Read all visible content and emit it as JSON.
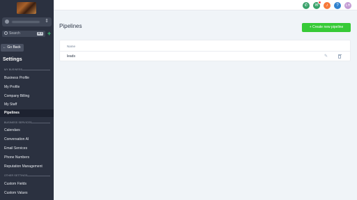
{
  "sidebar": {
    "search_label": "Search",
    "search_shortcut": "⌘ K",
    "add_icon": "+",
    "go_back": "← Go Back",
    "settings_title": "Settings",
    "sections": {
      "my_business": "MY BUSINESS",
      "business_services": "BUSINESS SERVICES",
      "other_settings": "OTHER SETTINGS"
    },
    "items": [
      {
        "label": "Business Profile"
      },
      {
        "label": "My Profile"
      },
      {
        "label": "Company Billing"
      },
      {
        "label": "My Staff"
      },
      {
        "label": "Pipelines",
        "active": true
      },
      {
        "label": "Calendars"
      },
      {
        "label": "Conversation AI"
      },
      {
        "label": "Email Services"
      },
      {
        "label": "Phone Numbers"
      },
      {
        "label": "Reputation Management"
      },
      {
        "label": "Custom Fields"
      },
      {
        "label": "Custom Values"
      }
    ]
  },
  "topbar": {
    "icons": [
      {
        "name": "phone-icon",
        "glyph": "✆",
        "color": "#38a169"
      },
      {
        "name": "megaphone-icon",
        "glyph": "✉",
        "color": "#38a169"
      },
      {
        "name": "bell-icon",
        "glyph": "♪",
        "color": "#f6793a"
      },
      {
        "name": "help-icon",
        "glyph": "?",
        "color": "#3182ce"
      }
    ],
    "avatar": "LH",
    "avatar_color": "#c39bd3"
  },
  "main": {
    "title": "Pipelines",
    "create_button": "+ Create new pipeline",
    "accent_color": "#37ca37",
    "table": {
      "columns": [
        "Name"
      ],
      "rows": [
        {
          "name": "leads"
        }
      ]
    }
  }
}
